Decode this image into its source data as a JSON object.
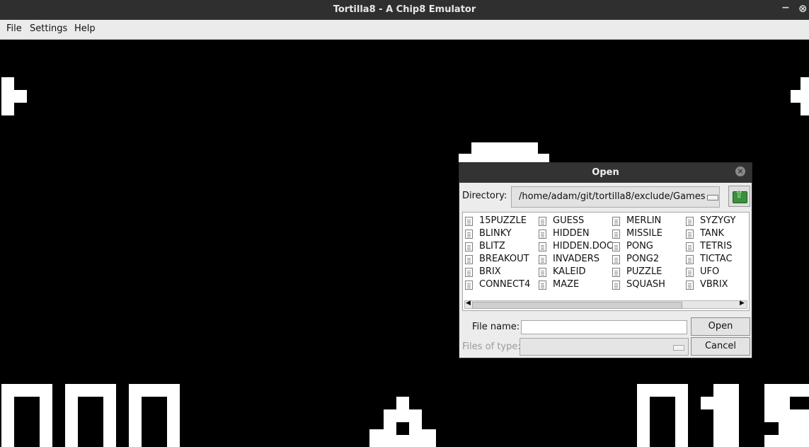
{
  "window": {
    "title": "Tortilla8 - A Chip8 Emulator",
    "minimize_glyph": "−",
    "close_glyph": "⊗"
  },
  "menu": [
    {
      "label": "File"
    },
    {
      "label": "Settings"
    },
    {
      "label": "Help"
    }
  ],
  "dialog": {
    "title": "Open",
    "close_glyph": "×",
    "directory_label": "Directory:",
    "directory_value": "/home/adam/git/tortilla8/exclude/Games",
    "up_icon": "folder-up-icon",
    "files": [
      [
        "15PUZZLE",
        "BLINKY",
        "BLITZ",
        "BREAKOUT",
        "BRIX",
        "CONNECT4"
      ],
      [
        "GUESS",
        "HIDDEN",
        "HIDDEN.DOC",
        "INVADERS",
        "KALEID",
        "MAZE"
      ],
      [
        "MERLIN",
        "MISSILE",
        "PONG",
        "PONG2",
        "PUZZLE",
        "SQUASH"
      ],
      [
        "SYZYGY",
        "TANK",
        "TETRIS",
        "TICTAC",
        "UFO",
        "VBRIX"
      ]
    ],
    "file_name_label": "File name:",
    "file_name_value": "",
    "files_of_type_label": "Files of type:",
    "files_of_type_value": "",
    "open_button": "Open",
    "cancel_button": "Cancel",
    "scroll_left": "◀",
    "scroll_right": "▶"
  },
  "colors": {
    "screen_bg": "#000000",
    "pixel": "#ffffff",
    "titlebar": "#2f2f2f"
  }
}
